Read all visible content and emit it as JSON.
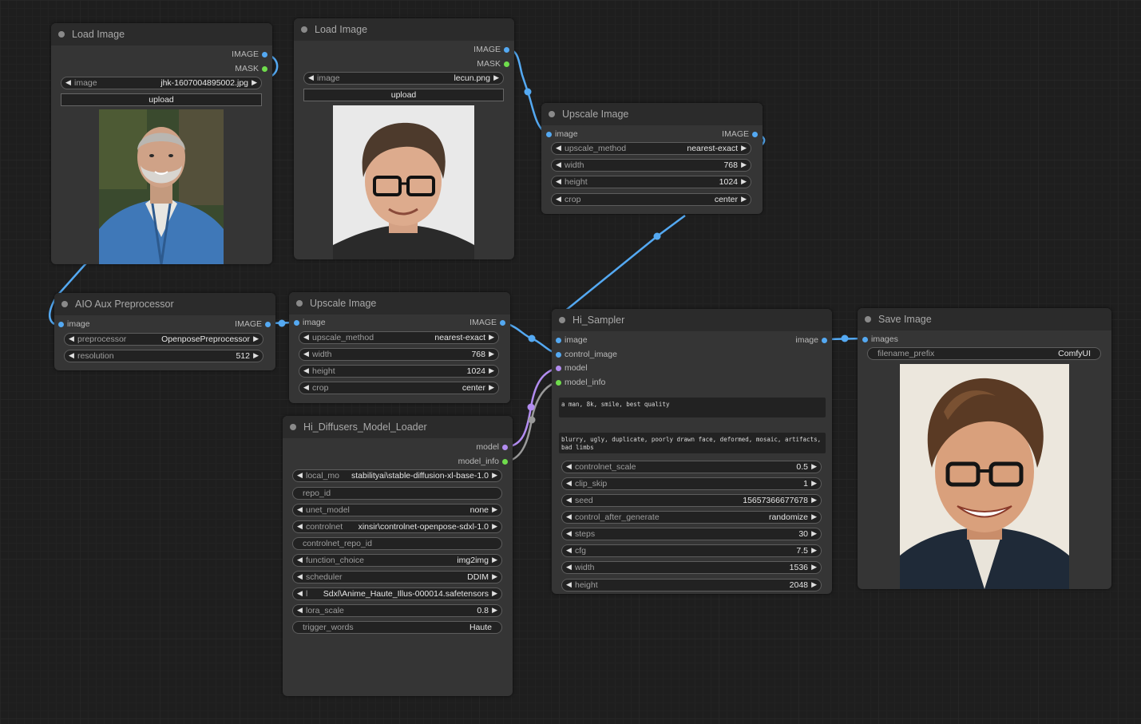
{
  "nodes": {
    "load1": {
      "title": "Load Image",
      "out_image": "IMAGE",
      "out_mask": "MASK",
      "image_label": "image",
      "image_value": "jhk-1607004895002.jpg",
      "upload": "upload"
    },
    "load2": {
      "title": "Load Image",
      "out_image": "IMAGE",
      "out_mask": "MASK",
      "image_label": "image",
      "image_value": "lecun.png",
      "upload": "upload"
    },
    "upscale1": {
      "title": "Upscale Image",
      "in_image": "image",
      "out_image": "IMAGE",
      "widgets": [
        {
          "label": "upscale_method",
          "value": "nearest-exact"
        },
        {
          "label": "width",
          "value": "768"
        },
        {
          "label": "height",
          "value": "1024"
        },
        {
          "label": "crop",
          "value": "center"
        }
      ]
    },
    "aio": {
      "title": "AIO Aux Preprocessor",
      "in_image": "image",
      "out_image": "IMAGE",
      "widgets": [
        {
          "label": "preprocessor",
          "value": "OpenposePreprocessor"
        },
        {
          "label": "resolution",
          "value": "512"
        }
      ]
    },
    "upscale2": {
      "title": "Upscale Image",
      "in_image": "image",
      "out_image": "IMAGE",
      "widgets": [
        {
          "label": "upscale_method",
          "value": "nearest-exact"
        },
        {
          "label": "width",
          "value": "768"
        },
        {
          "label": "height",
          "value": "1024"
        },
        {
          "label": "crop",
          "value": "center"
        }
      ]
    },
    "loader": {
      "title": "Hi_Diffusers_Model_Loader",
      "out_model": "model",
      "out_model_info": "model_info",
      "widgets": [
        {
          "label": "local_mo",
          "value": "stabilityai\\stable-diffusion-xl-base-1.0",
          "kind": "combo"
        },
        {
          "label": "repo_id",
          "value": "",
          "kind": "text"
        },
        {
          "label": "unet_model",
          "value": "none",
          "kind": "combo"
        },
        {
          "label": "controlnet",
          "value": "xinsir\\controlnet-openpose-sdxl-1.0",
          "kind": "combo"
        },
        {
          "label": "controlnet_repo_id",
          "value": "",
          "kind": "text"
        },
        {
          "label": "function_choice",
          "value": "img2img",
          "kind": "combo"
        },
        {
          "label": "scheduler",
          "value": "DDIM",
          "kind": "combo"
        },
        {
          "label": "l",
          "value": "Sdxl\\Anime_Haute_Illus-000014.safetensors",
          "kind": "combo"
        },
        {
          "label": "lora_scale",
          "value": "0.8",
          "kind": "combo"
        },
        {
          "label": "trigger_words",
          "value": "Haute",
          "kind": "text"
        }
      ]
    },
    "sampler": {
      "title": "Hi_Sampler",
      "in_image": "image",
      "in_control_image": "control_image",
      "in_model": "model",
      "in_model_info": "model_info",
      "out_image": "image",
      "positive": "a man, 8k, smile, best quality",
      "negative": "blurry, ugly, duplicate, poorly drawn face, deformed, mosaic, artifacts, bad limbs",
      "widgets": [
        {
          "label": "controlnet_scale",
          "value": "0.5"
        },
        {
          "label": "clip_skip",
          "value": "1"
        },
        {
          "label": "seed",
          "value": "15657366677678"
        },
        {
          "label": "control_after_generate",
          "value": "randomize"
        },
        {
          "label": "steps",
          "value": "30"
        },
        {
          "label": "cfg",
          "value": "7.5"
        },
        {
          "label": "width",
          "value": "1536"
        },
        {
          "label": "height",
          "value": "2048"
        }
      ]
    },
    "save": {
      "title": "Save Image",
      "in_images": "images",
      "prefix_label": "filename_prefix",
      "prefix_value": "ComfyUI"
    }
  },
  "colors": {
    "image_link": "#54a9f2",
    "model_link": "#b28cf0",
    "model_info_link": "#9a9a9a",
    "node_bg": "#353535",
    "canvas_bg": "#1e1e1e"
  }
}
